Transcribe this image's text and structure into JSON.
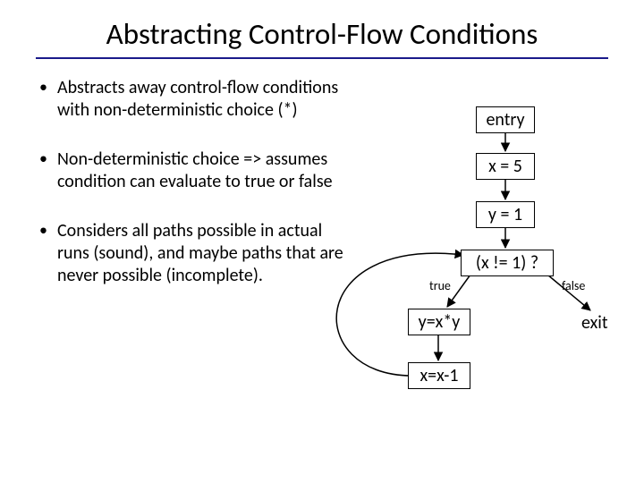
{
  "title": "Abstracting Control-Flow Conditions",
  "bullets": [
    "Abstracts away control-flow conditions with non-deterministic choice (*)",
    "Non-deterministic choice => assumes condition can evaluate to true or false",
    "Considers all paths possible in actual runs (sound), and maybe paths that are never possible (incomplete)."
  ],
  "flow": {
    "entry": "entry",
    "n1": "x = 5",
    "n2": "y = 1",
    "cond": "(x != 1) ?",
    "true_label": "true",
    "false_label": "false",
    "n3": "y=x*y",
    "n4": "x=x-1",
    "exit": "exit"
  }
}
